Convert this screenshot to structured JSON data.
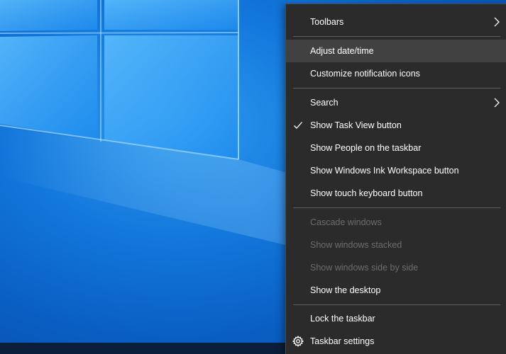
{
  "context_menu": {
    "items": [
      {
        "label": "Toolbars"
      },
      {
        "label": "Adjust date/time"
      },
      {
        "label": "Customize notification icons"
      },
      {
        "label": "Search"
      },
      {
        "label": "Show Task View button",
        "checked": true
      },
      {
        "label": "Show People on the taskbar"
      },
      {
        "label": "Show Windows Ink Workspace button"
      },
      {
        "label": "Show touch keyboard button"
      },
      {
        "label": "Cascade windows",
        "disabled": true
      },
      {
        "label": "Show windows stacked",
        "disabled": true
      },
      {
        "label": "Show windows side by side",
        "disabled": true
      },
      {
        "label": "Show the desktop"
      },
      {
        "label": "Lock the taskbar"
      },
      {
        "label": "Taskbar settings",
        "icon": "gear-icon"
      }
    ]
  },
  "colors": {
    "menu_background": "#2b2b2b",
    "hover_background": "#414141",
    "disabled_text": "#6d6d6d",
    "separator": "#5e5e5e",
    "desktop_blue": "#1378dc"
  }
}
